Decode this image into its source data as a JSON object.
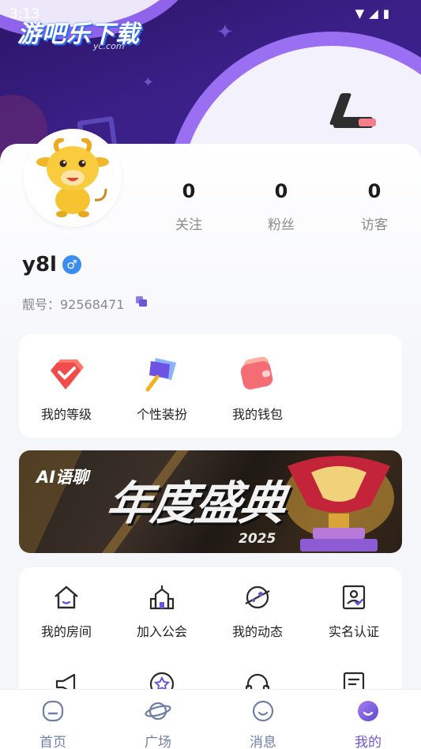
{
  "status_bar": {
    "time": "3:13"
  },
  "watermark": {
    "title": "游吧乐下载",
    "sub": "yc.com"
  },
  "profile": {
    "username": "y8l",
    "gender_symbol": "♂",
    "id_text": "靓号：92568471",
    "stats": [
      {
        "value": "0",
        "label": "关注"
      },
      {
        "value": "0",
        "label": "粉丝"
      },
      {
        "value": "0",
        "label": "访客"
      }
    ]
  },
  "quick_actions": [
    {
      "label": "我的等级",
      "icon": "level-gem-icon"
    },
    {
      "label": "个性装扮",
      "icon": "dress-up-icon"
    },
    {
      "label": "我的钱包",
      "icon": "wallet-icon"
    }
  ],
  "banner": {
    "brand": "AI语聊",
    "headline": "年度盛典",
    "year": "2025"
  },
  "grid_items": [
    {
      "label": "我的房间",
      "icon": "house-icon"
    },
    {
      "label": "加入公会",
      "icon": "guild-building-icon"
    },
    {
      "label": "我的动态",
      "icon": "planet-icon"
    },
    {
      "label": "实名认证",
      "icon": "id-verify-icon"
    },
    {
      "label": "",
      "icon": "megaphone-icon"
    },
    {
      "label": "",
      "icon": "star-badge-icon"
    },
    {
      "label": "",
      "icon": "headset-icon"
    },
    {
      "label": "",
      "icon": "document-icon"
    }
  ],
  "bottom_nav": [
    {
      "label": "首页",
      "icon": "home-icon"
    },
    {
      "label": "广场",
      "icon": "saturn-icon"
    },
    {
      "label": "消息",
      "icon": "message-icon"
    },
    {
      "label": "我的",
      "icon": "profile-icon",
      "active": true
    }
  ],
  "colors": {
    "accent": "#6b57d6",
    "nav_inactive": "#6f7fa6",
    "hero": "#3a1f86"
  }
}
